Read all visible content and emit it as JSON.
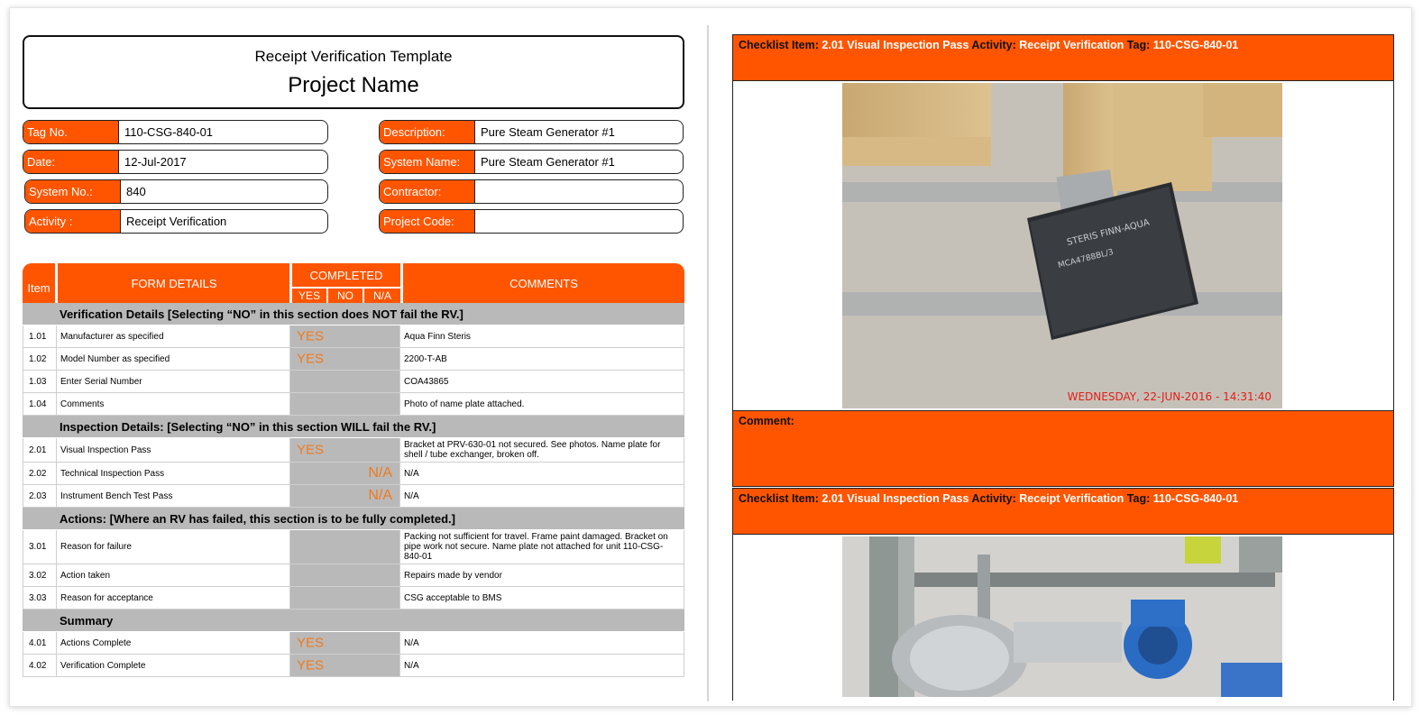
{
  "header": {
    "template_title": "Receipt Verification Template",
    "project_name": "Project Name"
  },
  "info_left": [
    {
      "label": "Tag No.",
      "value": "110-CSG-840-01"
    },
    {
      "label": "Date:",
      "value": "12-Jul-2017"
    },
    {
      "label": "System No.:",
      "value": "840"
    },
    {
      "label": "Activity :",
      "value": "Receipt Verification"
    }
  ],
  "info_right": [
    {
      "label": "Description:",
      "value": "Pure Steam Generator #1"
    },
    {
      "label": "System Name:",
      "value": "Pure Steam Generator #1"
    },
    {
      "label": "Contractor:",
      "value": ""
    },
    {
      "label": "Project Code:",
      "value": ""
    }
  ],
  "table_header": {
    "item": "Item",
    "form_details": "FORM DETAILS",
    "completed": "COMPLETED",
    "yes": "YES",
    "no": "NO",
    "na": "N/A",
    "comments": "COMMENTS"
  },
  "sections": [
    {
      "title": "Verification Details [Selecting “NO” in this section does NOT fail the RV.]",
      "rows": [
        {
          "item": "1.01",
          "detail": "Manufacturer as specified",
          "status": "YES",
          "comment": "Aqua Finn Steris"
        },
        {
          "item": "1.02",
          "detail": "Model Number as specified",
          "status": "YES",
          "comment": "2200-T-AB"
        },
        {
          "item": "1.03",
          "detail": "Enter Serial Number",
          "status": "",
          "comment": "COA43865"
        },
        {
          "item": "1.04",
          "detail": "Comments",
          "status": "",
          "comment": "Photo of name plate attached."
        }
      ]
    },
    {
      "title": "Inspection Details: [Selecting “NO” in this section WILL fail the RV.]",
      "rows": [
        {
          "item": "2.01",
          "detail": "Visual Inspection Pass",
          "status": "YES",
          "comment": "Bracket at PRV-630-01 not secured. See photos. Name plate for shell / tube exchanger, broken off."
        },
        {
          "item": "2.02",
          "detail": "Technical Inspection Pass",
          "status": "N/A",
          "comment": "N/A"
        },
        {
          "item": "2.03",
          "detail": "Instrument Bench Test Pass",
          "status": "N/A",
          "comment": "N/A"
        }
      ]
    },
    {
      "title": "Actions: [Where an RV has failed, this section is to be fully completed.]",
      "rows": [
        {
          "item": "3.01",
          "detail": "Reason for failure",
          "status": "",
          "comment": "Packing not sufficient for travel. Frame paint damaged. Bracket on pipe work not secure. Name plate not attached for unit 110-CSG-840-01"
        },
        {
          "item": "3.02",
          "detail": "Action taken",
          "status": "",
          "comment": "Repairs made by vendor"
        },
        {
          "item": "3.03",
          "detail": "Reason for acceptance",
          "status": "",
          "comment": "CSG acceptable to BMS"
        }
      ]
    },
    {
      "title": "Summary",
      "rows": [
        {
          "item": "4.01",
          "detail": "Actions Complete",
          "status": "YES",
          "comment": "N/A"
        },
        {
          "item": "4.02",
          "detail": "Verification Complete",
          "status": "YES",
          "comment": "N/A"
        }
      ]
    }
  ],
  "photo_panels": [
    {
      "checklist_key": "Checklist Item:",
      "checklist_value": "2.01 Visual Inspection Pass",
      "activity_key": "Activity:",
      "activity_value": "Receipt Verification",
      "tag_key": "Tag:",
      "tag_value": "110-CSG-840-01",
      "photo_timestamp": "WEDNESDAY, 22-JUN-2016 - 14:31:40",
      "comment_label": "Comment:"
    },
    {
      "checklist_key": "Checklist Item:",
      "checklist_value": "2.01 Visual Inspection Pass",
      "activity_key": "Activity:",
      "activity_value": "Receipt Verification",
      "tag_key": "Tag:",
      "tag_value": "110-CSG-840-01"
    }
  ],
  "colors": {
    "accent": "#ff5500",
    "section_gray": "#b9b9b9",
    "status_text": "#f07a1c",
    "timestamp": "#e0201a"
  }
}
